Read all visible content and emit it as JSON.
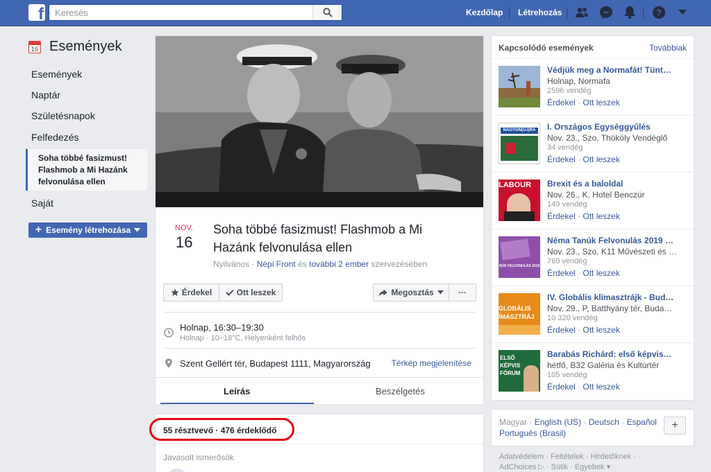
{
  "topbar": {
    "logo": "f",
    "search_placeholder": "Keresés",
    "nav": {
      "home": "Kezdőlap",
      "create": "Létrehozás"
    },
    "icons": [
      "friends-icon",
      "messenger-icon",
      "bell-icon",
      "help-icon",
      "caret-down-icon"
    ]
  },
  "sidebar": {
    "title": "Események",
    "calendar_day": "15",
    "items": [
      "Események",
      "Naptár",
      "Születésnapok",
      "Felfedezés"
    ],
    "selected": "Soha többé fasizmust! Flashmob a Mi Hazánk felvonulása ellen",
    "own": "Saját",
    "create_button": "Esemény létrehozása"
  },
  "event": {
    "month": "NOV.",
    "day": "16",
    "title": "Soha többé fasizmust! Flashmob a Mi Hazánk felvonulása ellen",
    "visibility": "Nyilvános",
    "dot": "·",
    "organizer": "Népi Front",
    "and": "és",
    "others": "további 2 ember",
    "organizing": "szervezésében",
    "buttons": {
      "interested": "Érdekel",
      "going": "Ott leszek",
      "share": "Megosztás",
      "more": "···"
    },
    "time_main": "Holnap, 16:30–19:30",
    "time_sub": "Holnap · 10–18°C, Helyenként felhős",
    "location": "Szent Gellért tér, Budapest 1111, Magyarország",
    "map_link": "Térkép megjelenítése",
    "tabs": [
      "Leírás",
      "Beszélgetés"
    ]
  },
  "attendees": {
    "count_text": "55 résztvevő · 476 érdeklődő",
    "suggested": "Javasolt ismerősök"
  },
  "related": {
    "header": "Kapcsolódó események",
    "more": "Továbbiak",
    "actions": {
      "interested": "Érdekel",
      "sep": "·",
      "going": "Ott leszek"
    },
    "items": [
      {
        "title": "Védjük meg a Normafát! Tünt…",
        "meta": "Holnap, Normafa",
        "count": "2596 vendég"
      },
      {
        "title": "I. Országos Egységgyűlés",
        "meta": "Nov. 23., Szo, Thököly Vendéglő",
        "count": "34 vendég",
        "thumb_text": "NAGYON(ÚJ)RA"
      },
      {
        "title": "Brexit és a baloldal",
        "meta": "Nov. 26., K, Hotel Benczúr",
        "count": "149 vendég",
        "thumb_text": "LABOUR"
      },
      {
        "title": "Néma Tanúk Felvonulás 2019 …",
        "meta": "Nov. 23., Szo, K11 Művészeti és …",
        "count": "769 vendég",
        "thumb_text": "NÚK FELVONULÁS 2019"
      },
      {
        "title": "IV. Globális klímasztrájk - Bud…",
        "meta": "Nov. 29., P, Batthyány tér, Buda…",
        "count": "10 320 vendég",
        "thumb_text": "GLOBÁLIS ÍMASZTRÁJ"
      },
      {
        "title": "Barabás Richárd: első képvis…",
        "meta": "hétfő, B32 Galéria és Kultúrtér",
        "count": "105 vendég",
        "thumb_text": "ELSŐ KÉPVIS FÓRUM"
      }
    ]
  },
  "languages": {
    "current": "Magyar",
    "sep": "·",
    "others": [
      "English (US)",
      "Deutsch",
      "Español",
      "Português (Brasil)"
    ],
    "plus": "+"
  },
  "footer": {
    "line1": "Adatvédelem · Feltételek · Hirdetőknek ·",
    "line2": "AdChoices ▷ · Sütik · Egyebek ▾"
  }
}
